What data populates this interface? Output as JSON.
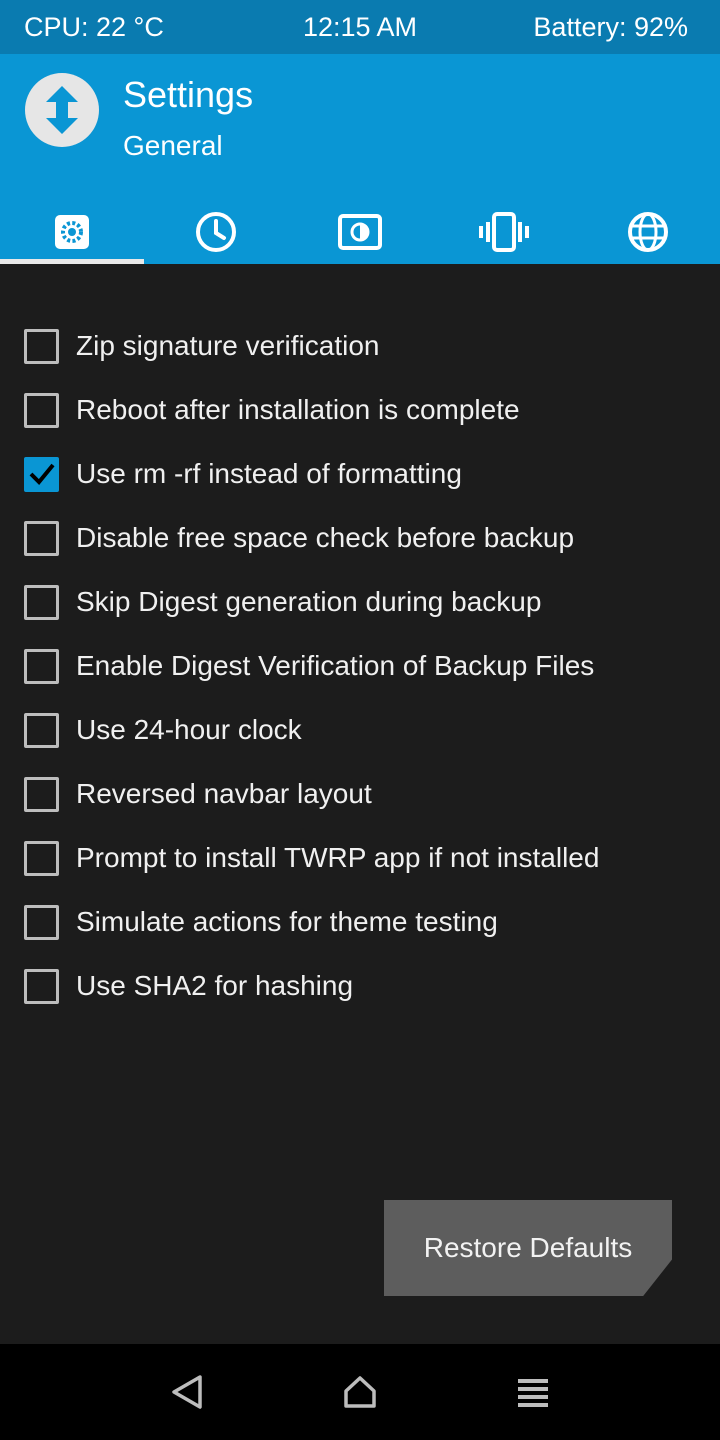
{
  "status_bar": {
    "cpu": "CPU: 22 °C",
    "time": "12:15 AM",
    "battery": "Battery: 92%"
  },
  "header": {
    "title": "Settings",
    "subtitle": "General",
    "logo_icon": "twrp-logo-icon"
  },
  "tabs": [
    {
      "icon": "gear-icon",
      "active": true
    },
    {
      "icon": "clock-icon",
      "active": false
    },
    {
      "icon": "brightness-icon",
      "active": false
    },
    {
      "icon": "vibrate-icon",
      "active": false
    },
    {
      "icon": "globe-icon",
      "active": false
    }
  ],
  "settings": {
    "items": [
      {
        "label": "Zip signature verification",
        "checked": false
      },
      {
        "label": "Reboot after installation is complete",
        "checked": false
      },
      {
        "label": "Use rm -rf instead of formatting",
        "checked": true
      },
      {
        "label": "Disable free space check before backup",
        "checked": false
      },
      {
        "label": "Skip Digest generation during backup",
        "checked": false
      },
      {
        "label": "Enable Digest Verification of Backup Files",
        "checked": false
      },
      {
        "label": "Use 24-hour clock",
        "checked": false
      },
      {
        "label": "Reversed navbar layout",
        "checked": false
      },
      {
        "label": "Prompt to install TWRP app if not installed",
        "checked": false
      },
      {
        "label": "Simulate actions for theme testing",
        "checked": false
      },
      {
        "label": "Use SHA2 for hashing",
        "checked": false
      }
    ]
  },
  "restore_button": {
    "label": "Restore Defaults"
  },
  "navbar": {
    "back_icon": "back-triangle-icon",
    "home_icon": "home-icon",
    "menu_icon": "menu-icon"
  },
  "colors": {
    "status_bar_bg": "#0a7bb0",
    "header_bg": "#0a96d4",
    "body_bg": "#1c1c1c",
    "checkbox_checked": "#0a96d4",
    "button_bg": "#5d5d5d"
  }
}
